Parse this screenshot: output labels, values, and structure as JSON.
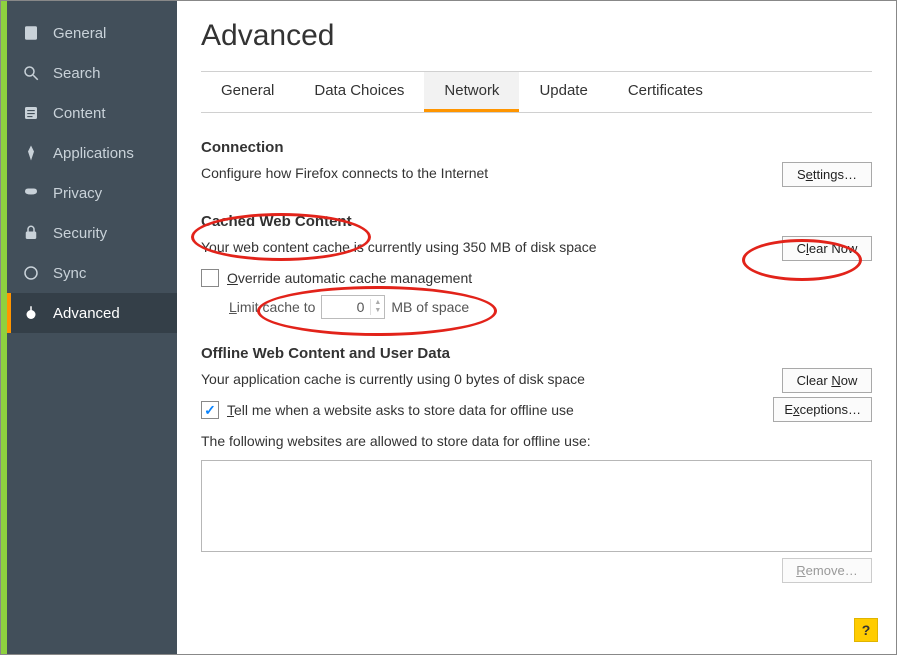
{
  "sidebar": {
    "items": [
      {
        "label": "General"
      },
      {
        "label": "Search"
      },
      {
        "label": "Content"
      },
      {
        "label": "Applications"
      },
      {
        "label": "Privacy"
      },
      {
        "label": "Security"
      },
      {
        "label": "Sync"
      },
      {
        "label": "Advanced"
      }
    ]
  },
  "page": {
    "title": "Advanced"
  },
  "tabs": [
    {
      "label": "General"
    },
    {
      "label": "Data Choices"
    },
    {
      "label": "Network"
    },
    {
      "label": "Update"
    },
    {
      "label": "Certificates"
    }
  ],
  "connection": {
    "heading": "Connection",
    "desc": "Configure how Firefox connects to the Internet",
    "settings_btn": "Settings…"
  },
  "cached": {
    "heading": "Cached Web Content",
    "desc": "Your web content cache is currently using 350 MB of disk space",
    "clear_btn_pre": "C",
    "clear_btn_u": "l",
    "clear_btn_post": "ear Now",
    "override_pre": "",
    "override_u": "O",
    "override_post": "verride automatic cache management",
    "limit_pre": "",
    "limit_u": "L",
    "limit_post": "imit cache to",
    "limit_value": "0",
    "limit_suffix": "MB of space"
  },
  "offline": {
    "heading": "Offline Web Content and User Data",
    "desc": "Your application cache is currently using 0 bytes of disk space",
    "clear_btn_pre": "Clear ",
    "clear_btn_u": "N",
    "clear_btn_post": "ow",
    "tell_pre": "",
    "tell_u": "T",
    "tell_post": "ell me when a website asks to store data for offline use",
    "exceptions_pre": "E",
    "exceptions_u": "x",
    "exceptions_post": "ceptions…",
    "following": "The following websites are allowed to store data for offline use:",
    "remove_pre": "",
    "remove_u": "R",
    "remove_post": "emove…"
  },
  "help": "?"
}
